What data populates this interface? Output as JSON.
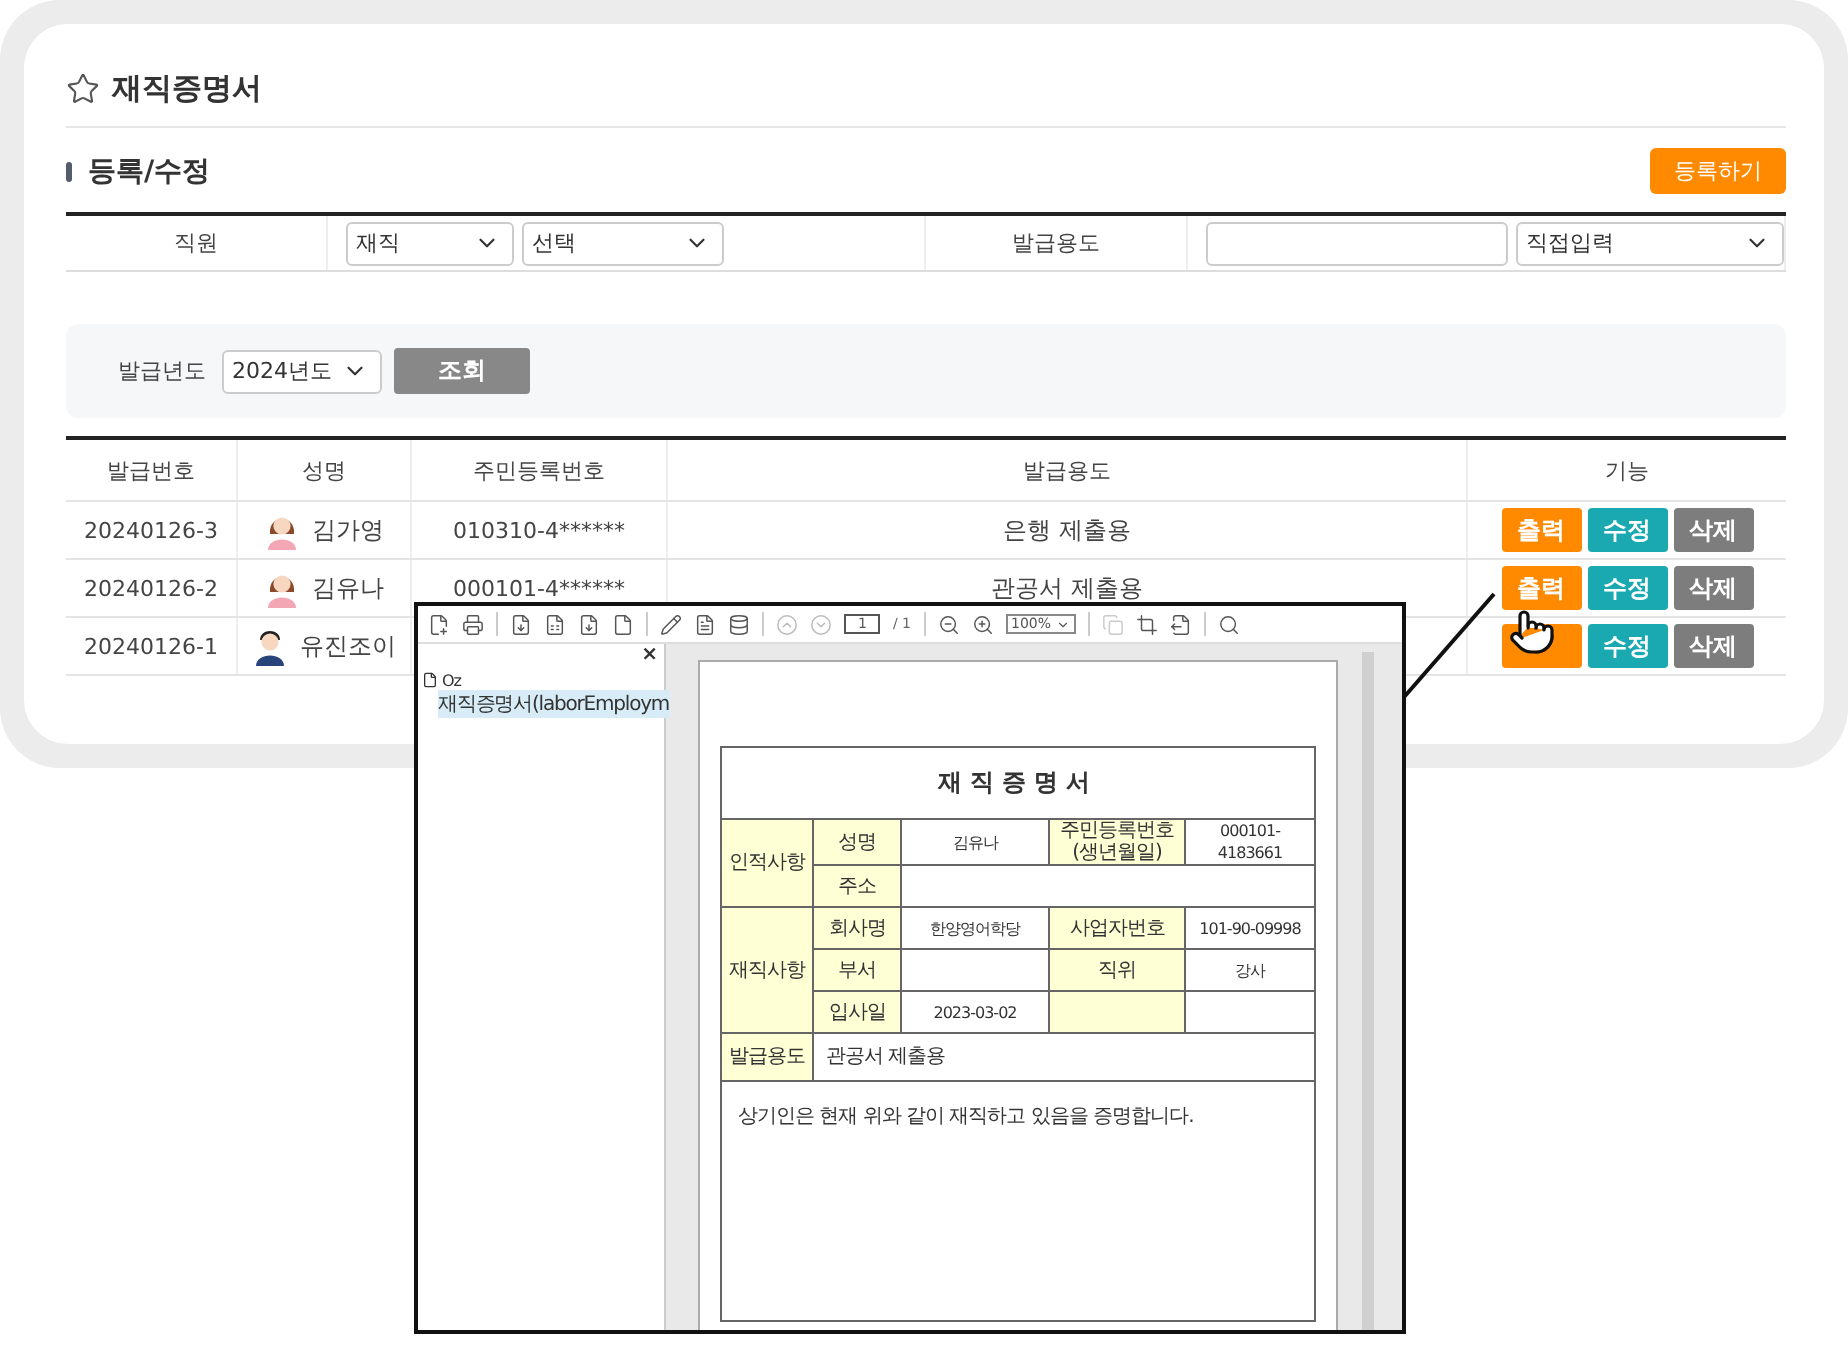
{
  "page": {
    "title": "재직증명서"
  },
  "section": {
    "title": "등록/수정",
    "register_button": "등록하기"
  },
  "form": {
    "employee_label": "직원",
    "status_select": "재직",
    "employee_select": "선택",
    "purpose_label": "발급용도",
    "purpose_select": "직접입력"
  },
  "search": {
    "label": "발급년도",
    "year_select": "2024년도",
    "button": "조회"
  },
  "table": {
    "columns": [
      "발급번호",
      "성명",
      "주민등록번호",
      "발급용도",
      "기능"
    ],
    "rows": [
      {
        "issue_no": "20240126-3",
        "avatar": {
          "kind": "female"
        },
        "name": "김가영",
        "resident_no": "010310-4******",
        "purpose": "은행 제출용",
        "actions": [
          {
            "kind": "print",
            "label": "출력"
          },
          {
            "kind": "edit",
            "label": "수정"
          },
          {
            "kind": "delete",
            "label": "삭제"
          }
        ]
      },
      {
        "issue_no": "20240126-2",
        "avatar": {
          "kind": "female"
        },
        "name": "김유나",
        "resident_no": "000101-4******",
        "purpose": "관공서 제출용",
        "actions": [
          {
            "kind": "print",
            "label": "출력"
          },
          {
            "kind": "edit",
            "label": "수정"
          },
          {
            "kind": "delete",
            "label": "삭제"
          }
        ]
      },
      {
        "issue_no": "20240126-1",
        "avatar": {
          "kind": "male"
        },
        "name": "유진조이",
        "actions": [
          {
            "kind": "print"
          },
          {
            "kind": "edit",
            "label": "수정"
          },
          {
            "kind": "delete",
            "label": "삭제"
          }
        ]
      }
    ]
  },
  "viewer": {
    "page_input": "1",
    "page_total": "/ 1",
    "zoom": "100%",
    "close": "×",
    "tree": [
      {
        "label": "Oz",
        "selected": false,
        "children": [
          {
            "label": "재직증명서(laborEmploym",
            "selected": true
          }
        ]
      }
    ],
    "document": {
      "title": "재직증명서",
      "groups": [
        {
          "label": "인적사항",
          "rows": [
            [
              {
                "kind": "field",
                "label": "성명",
                "value": "김유나"
              },
              {
                "kind": "field",
                "label": "주민등록번호",
                "sublabel": "(생년월일)",
                "value": "000101-4183661"
              }
            ],
            [
              {
                "kind": "field",
                "label": "주소"
              }
            ]
          ]
        },
        {
          "label": "재직사항",
          "rows": [
            [
              {
                "kind": "field",
                "label": "회사명",
                "value": "한양영어학당"
              },
              {
                "kind": "field",
                "label": "사업자번호",
                "value": "101-90-09998"
              }
            ],
            [
              {
                "kind": "field",
                "label": "부서"
              },
              {
                "kind": "field",
                "label": "직위",
                "value": "강사"
              }
            ],
            [
              {
                "kind": "field",
                "label": "입사일",
                "value": "2023-03-02"
              },
              {
                "kind": "blank"
              }
            ]
          ]
        }
      ],
      "purpose": {
        "label": "발급용도",
        "value": "관공서 제출용"
      },
      "statement": "상기인은 현재 위와 같이 재직하고 있음을 증명합니다."
    }
  }
}
